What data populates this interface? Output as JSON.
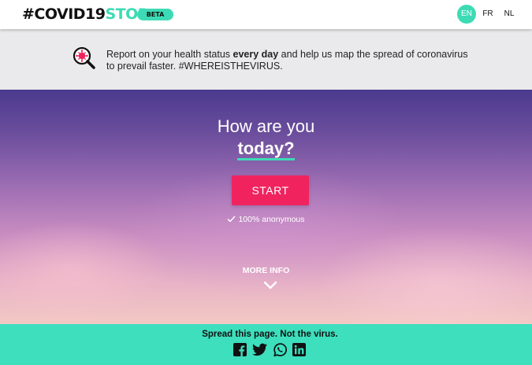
{
  "header": {
    "logo_part1": "#COVID19",
    "logo_part2": "STOP",
    "badge": "BETA",
    "languages": [
      "EN",
      "FR",
      "NL"
    ],
    "active_language": "EN"
  },
  "infobar": {
    "icon": "virus-magnifier-icon",
    "text_before": "Report on your health status ",
    "text_bold": "every day",
    "text_after": " and help us map the spread of coronavirus to prevail faster. #WHEREISTHEVIRUS."
  },
  "hero": {
    "title": "How are you",
    "subtitle": "today?",
    "start_label": "START",
    "anonymous_label": "100% anonymous",
    "more_info_label": "MORE INFO"
  },
  "footer": {
    "text": "Spread this page. Not the virus.",
    "social": [
      "facebook-icon",
      "twitter-icon",
      "whatsapp-icon",
      "linkedin-icon"
    ]
  },
  "colors": {
    "accent": "#3ddbb5",
    "start_button": "#f0235f",
    "infobar_bg": "#eaeaec",
    "footer_bg": "#3ddfbd"
  }
}
